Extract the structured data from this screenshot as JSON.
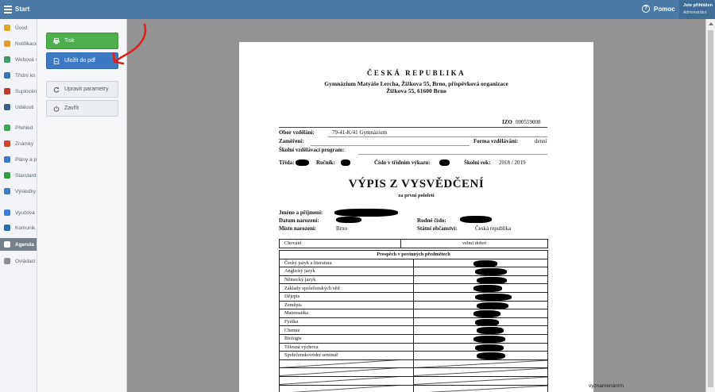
{
  "topbar": {
    "title": "Start",
    "help": "Pomoc",
    "user_line1": "Jste přihlášen",
    "user_line2": "Administrátor"
  },
  "sidebar": {
    "items": [
      {
        "label": "Úvod",
        "color": "#e0a526"
      },
      {
        "label": "Notifikace",
        "color": "#e39b2e"
      },
      {
        "label": "Webová s",
        "color": "#3d9b6a"
      },
      {
        "label": "Třídní kn",
        "color": "#3a74b8"
      },
      {
        "label": "Suplován",
        "color": "#c0392b"
      },
      {
        "label": "Události",
        "color": "#3a5f88"
      },
      {
        "label": "Přehled",
        "color": "#3aa655"
      },
      {
        "label": "Známky",
        "color": "#d0432f"
      },
      {
        "label": "Plány a p",
        "color": "#3a78c4"
      },
      {
        "label": "Standard",
        "color": "#2f9e44"
      },
      {
        "label": "Výsledky",
        "color": "#3d7ac1"
      },
      {
        "label": "Vyučová",
        "color": "#3b7dd8"
      },
      {
        "label": "Komunik",
        "color": "#2b6cb0"
      },
      {
        "label": "Agenda",
        "color": "#ffffff"
      },
      {
        "label": "Ovládací",
        "color": "#8a8f96"
      }
    ]
  },
  "panel": {
    "print_label": "Tisk",
    "pdf_label": "Uložit do pdf",
    "params_label": "Upravit parametry",
    "close_label": "Zavřít"
  },
  "doc": {
    "country": "ČESKÁ REPUBLIKA",
    "school": "Gymnázium Matyáše Lercha, Žižkova 55, Brno, příspěvková organizace",
    "address": "Žižkova 55, 61600 Brno",
    "izo_label": "IZO",
    "izo_value": "000559008",
    "obor_label": "Obor vzdělání:",
    "obor_value": "79-41-K/41  Gymnázium",
    "zamereni_label": "Zaměření:",
    "forma_label": "Forma vzdělávání:",
    "forma_value": "denní",
    "program_label": "Školní vzdělávací program:",
    "trida_label": "Třída:",
    "rocnik_label": "Ročník:",
    "vykaz_label": "Číslo v třídním výkazu:",
    "rok_label": "Školní rok:",
    "rok_value": "2018 / 2019",
    "title": "VÝPIS Z VYSVĚDČENÍ",
    "subtitle": "za  první pololetí",
    "jmeno_label": "Jméno a příjmení:",
    "datum_label": "Datum narození:",
    "rodne_label": "Rodné číslo:",
    "misto_label": "Místo narození:",
    "misto_value": "Brno",
    "obcanstvi_label": "Státní občanství:",
    "obcanstvi_value": "Česká republika",
    "chovani_label": "Chování",
    "chovani_value": "velmi dobré",
    "prospech_header": "Prospěch v povinných předmětech",
    "subjects": [
      "Český jazyk a literatura",
      "Anglický jazyk",
      "Německý jazyk",
      "Základy společenských věd",
      "Dějepis",
      "Zeměpis",
      "Matematika",
      "Fyzika",
      "Chemie",
      "Biologie",
      "Tělesná výchova",
      "Společenskovědní seminář"
    ]
  },
  "footer_text": "vyznamenáním",
  "colors": {
    "topbar": "#4a7aa8",
    "print_button": "#4cae4c",
    "pdf_button": "#3b79c3",
    "annotation": "#e02020",
    "preview_bg": "#939393"
  }
}
